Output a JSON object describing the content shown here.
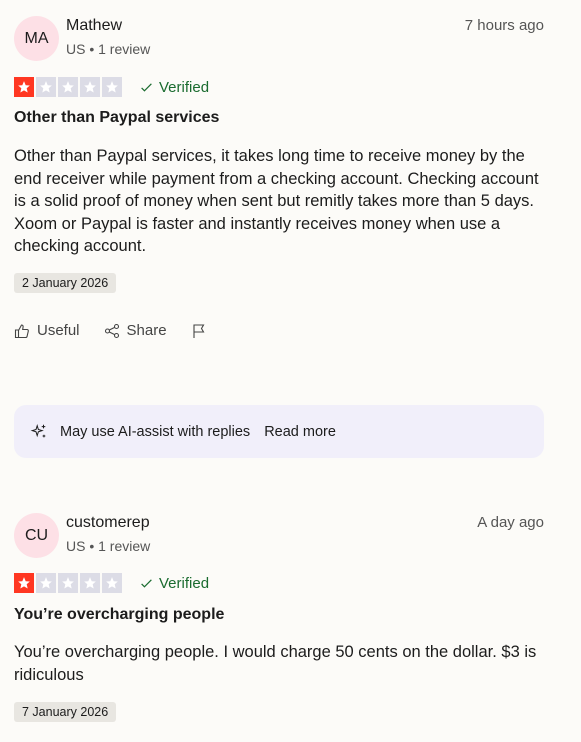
{
  "reviews": [
    {
      "initials": "MA",
      "name": "Mathew",
      "meta": "US • 1 review",
      "time": "7 hours ago",
      "rating": 1,
      "max_rating": 5,
      "verified_label": "Verified",
      "title": "Other than Paypal services",
      "body": "Other than Paypal services, it takes long time to receive money by the end receiver while payment from a checking account. Checking account is a solid proof of money when sent but remitly takes more than 5 days. Xoom or Paypal is faster and instantly receives money when use a checking account.",
      "date": "2 January 2026",
      "actions": {
        "useful": "Useful",
        "share": "Share"
      }
    },
    {
      "initials": "CU",
      "name": "customerep",
      "meta": "US • 1 review",
      "time": "A day ago",
      "rating": 1,
      "max_rating": 5,
      "verified_label": "Verified",
      "title": "You’re overcharging people",
      "body": "You’re overcharging people. I would charge 50 cents on the dollar. $3 is ridiculous",
      "date": "7 January 2026"
    }
  ],
  "ai_notice": {
    "text": "May use AI-assist with replies",
    "link": "Read more"
  },
  "colors": {
    "star_filled": "#ff3722",
    "star_empty": "#dcdce6",
    "verified": "#1a6b2f",
    "avatar_bg": "#fde0e6",
    "ai_box_bg": "#f1effa"
  },
  "icons": [
    "star-icon",
    "check-icon",
    "thumbs-up-icon",
    "share-icon",
    "flag-icon",
    "sparkle-icon"
  ]
}
